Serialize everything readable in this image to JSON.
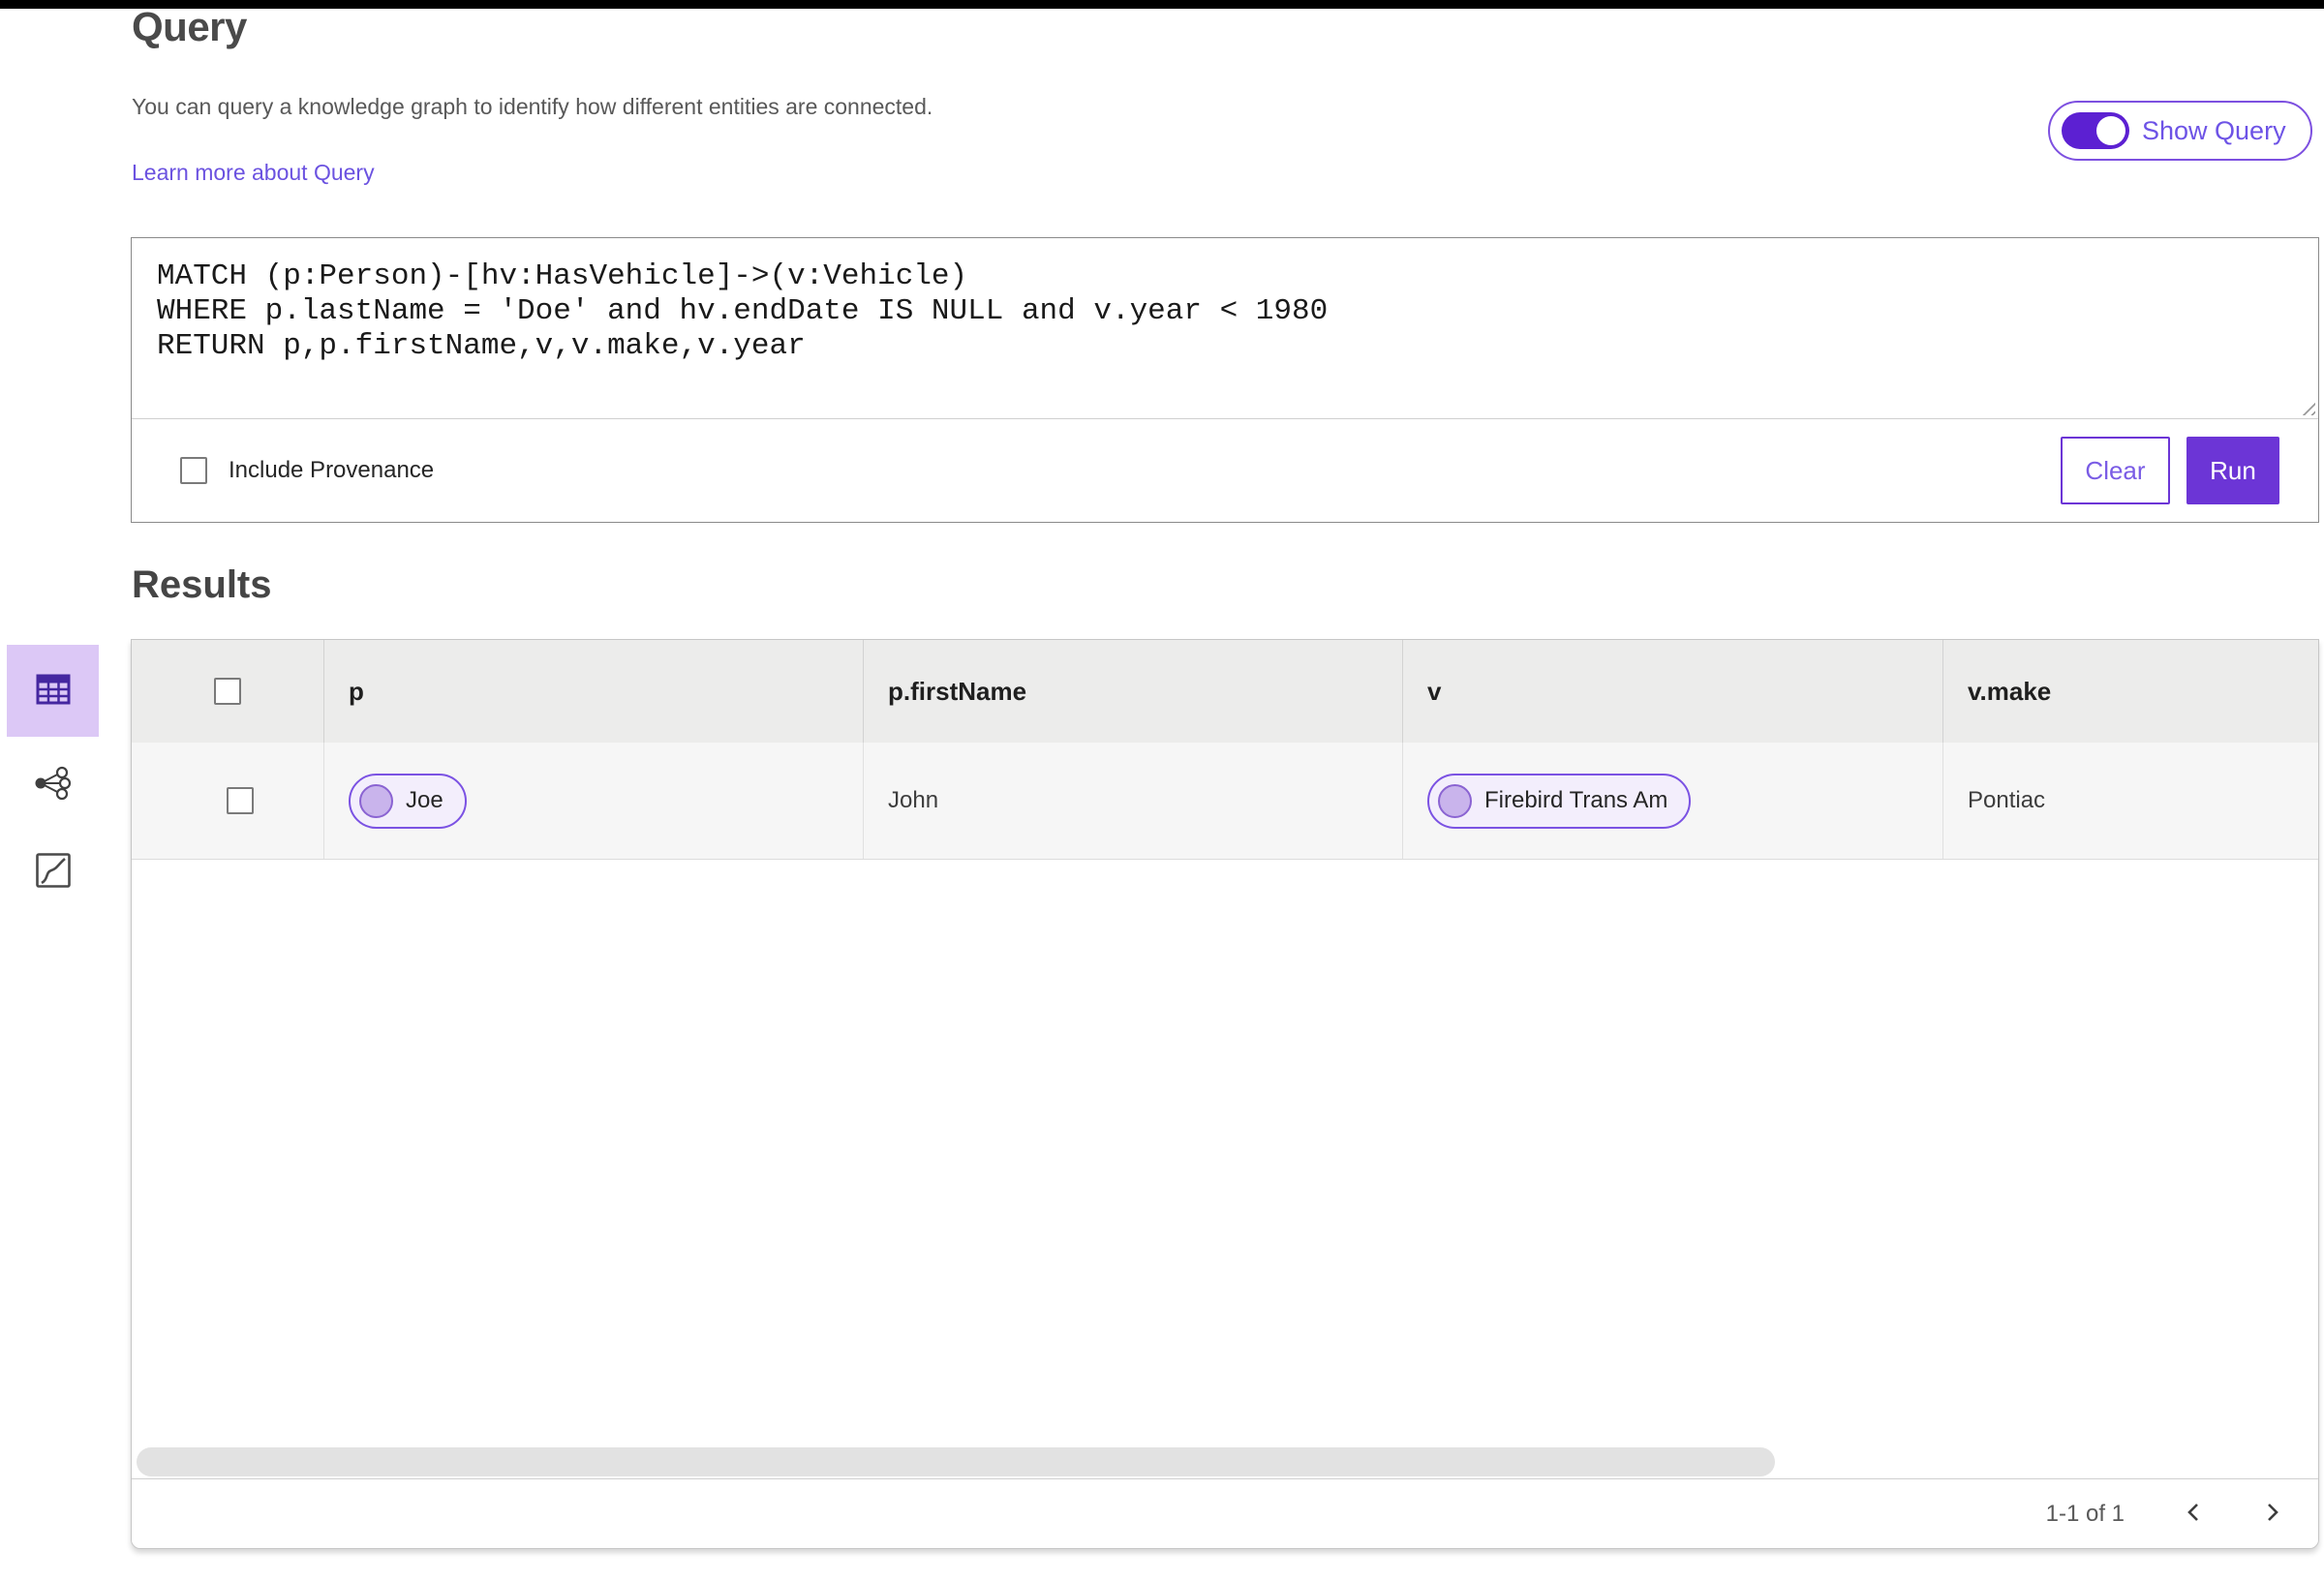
{
  "colors": {
    "accent_purple": "#6c35d6",
    "toggle_purple": "#5c20d2",
    "link_purple": "#6b52e0",
    "selected_tile_bg": "#dcc8f6",
    "chip_border": "#7b52e3",
    "chip_bg": "#f3eefc",
    "table_header_bg": "#ececeb",
    "table_row_bg": "#f6f6f6"
  },
  "header": {
    "title": "Query",
    "description": "You can query a knowledge graph to identify how different entities are connected.",
    "learn_more_label": "Learn more about Query",
    "show_query_label": "Show Query",
    "show_query_state": "on"
  },
  "query_panel": {
    "code": "MATCH (p:Person)-[hv:HasVehicle]->(v:Vehicle)\nWHERE p.lastName = 'Doe' and hv.endDate IS NULL and v.year < 1980\nRETURN p,p.firstName,v,v.make,v.year",
    "include_provenance_label": "Include Provenance",
    "include_provenance_checked": "unchecked",
    "clear_label": "Clear",
    "run_label": "Run"
  },
  "results": {
    "title": "Results",
    "views": [
      {
        "name": "table-view",
        "selected": "true"
      },
      {
        "name": "graph-view",
        "selected": "false"
      },
      {
        "name": "map-view",
        "selected": "false"
      }
    ],
    "table": {
      "columns": [
        "p",
        "p.firstName",
        "v",
        "v.make"
      ],
      "rows": [
        {
          "p_chip": "Joe",
          "p_firstName": "John",
          "v_chip": "Firebird Trans Am",
          "v_make": "Pontiac"
        }
      ]
    },
    "pagination": {
      "range_label": "1-1 of 1"
    }
  }
}
